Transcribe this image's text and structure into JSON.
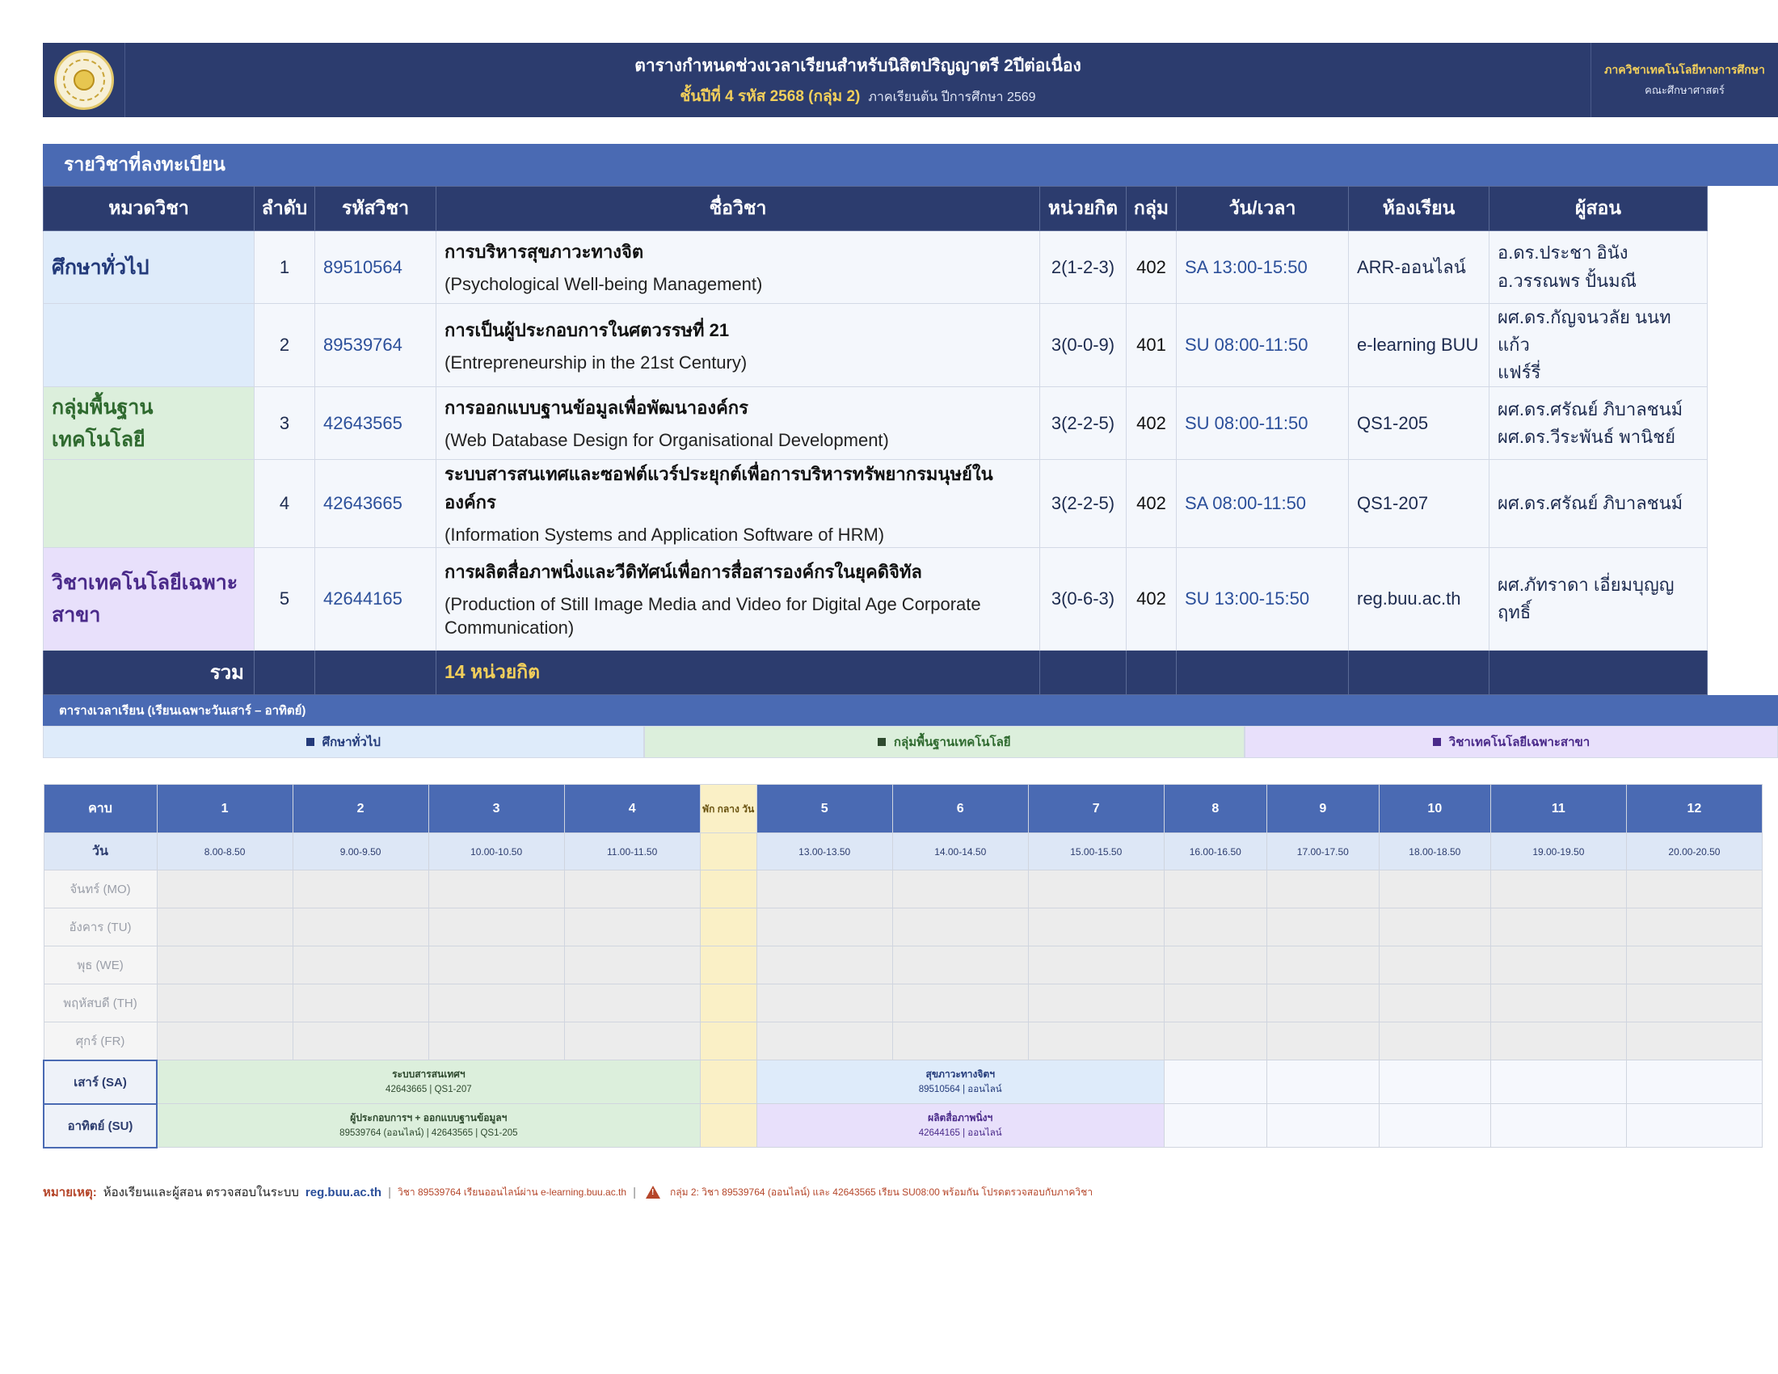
{
  "header": {
    "title": "ตารางกำหนดช่วงเวลาเรียนสำหรับนิสิตปริญญาตรี  2ปีต่อเนื่อง",
    "subtitle_highlight": "ชั้นปีที่ 4  รหัส 2568  (กลุ่ม 2)",
    "semester": "ภาคเรียนต้น ปีการศึกษา 2569",
    "dept": "ภาควิชาเทคโนโลยีทางการศึกษา",
    "faculty": "คณะศึกษาศาสตร์",
    "logo_icon": "university-seal-icon"
  },
  "courses": {
    "section_title": "รายวิชาที่ลงทะเบียน",
    "columns": [
      "หมวดวิชา",
      "ลำดับ",
      "รหัสวิชา",
      "ชื่อวิชา",
      "หน่วยกิต",
      "กลุ่ม",
      "วัน/เวลา",
      "ห้องเรียน",
      "ผู้สอน"
    ],
    "rows": [
      {
        "category": "ศึกษาทั่วไป",
        "no": "1",
        "code": "89510564",
        "name_th": "การบริหารสุขภาวะทางจิต",
        "name_en": "(Psychological Well-being Management)",
        "credits": "2(1-2-3)",
        "group": "402",
        "time": "SA 13:00-15:50",
        "room": "ARR-ออนไลน์",
        "inst1": "อ.ดร.ประชา อินัง",
        "inst2": "อ.วรรณพร ปั้นมณี"
      },
      {
        "category": "",
        "no": "2",
        "code": "89539764",
        "name_th": "การเป็นผู้ประกอบการในศตวรรษที่ 21",
        "name_en": "(Entrepreneurship in the 21st Century)",
        "credits": "3(0-0-9)",
        "group": "401",
        "time": "SU 08:00-11:50",
        "room": "e-learning BUU",
        "inst1": "ผศ.ดร.กัญจนวลัย นนทแก้ว",
        "inst2": "แฟร์รี่"
      },
      {
        "category": "กลุ่มพื้นฐานเทคโนโลยี",
        "no": "3",
        "code": "42643565",
        "name_th": "การออกแบบฐานข้อมูลเพื่อพัฒนาองค์กร",
        "name_en": "(Web Database Design for Organisational Development)",
        "credits": "3(2-2-5)",
        "group": "402",
        "time": "SU 08:00-11:50",
        "room": "QS1-205",
        "inst1": "ผศ.ดร.ศรัณย์ ภิบาลชนม์",
        "inst2": "ผศ.ดร.วีระพันธ์ พานิชย์"
      },
      {
        "category": "",
        "no": "4",
        "code": "42643665",
        "name_th": "ระบบสารสนเทศและซอฟต์แวร์ประยุกต์เพื่อการบริหารทรัพยากรมนุษย์ในองค์กร",
        "name_en": "(Information Systems and Application Software of HRM)",
        "credits": "3(2-2-5)",
        "group": "402",
        "time": "SA 08:00-11:50",
        "room": "QS1-207",
        "inst1": "ผศ.ดร.ศรัณย์ ภิบาลชนม์",
        "inst2": ""
      },
      {
        "category": "วิชาเทคโนโลยีเฉพาะสาขา",
        "no": "5",
        "code": "42644165",
        "name_th": "การผลิตสื่อภาพนิ่งและวีดิทัศน์เพื่อการสื่อสารองค์กรในยุคดิจิทัล",
        "name_en": "(Production of Still Image Media and Video for Digital Age Corporate Communication)",
        "credits": "3(0-6-3)",
        "group": "402",
        "time": "SU 13:00-15:50",
        "room": "reg.buu.ac.th",
        "inst1": "ผศ.ภัทราดา เอี่ยมบุญญฤทธิ์",
        "inst2": ""
      }
    ],
    "total_label": "รวม",
    "total_value": "14  หน่วยกิต"
  },
  "timetable": {
    "section_title": "ตารางเวลาเรียน  (เรียนเฉพาะวันเสาร์ – อาทิตย์)",
    "legend": [
      "ศึกษาทั่วไป",
      "กลุ่มพื้นฐานเทคโนโลยี",
      "วิชาเทคโนโลยีเฉพาะสาขา"
    ],
    "period_label": "คาบ",
    "day_label": "วัน",
    "lunch_label": "พัก กลาง วัน",
    "periods": [
      "1",
      "2",
      "3",
      "4",
      "5",
      "6",
      "7",
      "8",
      "9",
      "10",
      "11",
      "12"
    ],
    "times": [
      "8.00-8.50",
      "9.00-9.50",
      "10.00-10.50",
      "11.00-11.50",
      "13.00-13.50",
      "14.00-14.50",
      "15.00-15.50",
      "16.00-16.50",
      "17.00-17.50",
      "18.00-18.50",
      "19.00-19.50",
      "20.00-20.50"
    ],
    "weekdays": [
      "จันทร์ (MO)",
      "อังคาร (TU)",
      "พุธ (WE)",
      "พฤหัสบดี (TH)",
      "ศุกร์ (FR)"
    ],
    "saturday": {
      "label": "เสาร์ (SA)",
      "morning_title": "ระบบสารสนเทศฯ",
      "morning_detail": "42643665 | QS1-207",
      "afternoon_title": "สุขภาวะทางจิตฯ",
      "afternoon_detail": "89510564 | ออนไลน์"
    },
    "sunday": {
      "label": "อาทิตย์ (SU)",
      "morning_title": "ผู้ประกอบการฯ + ออกแบบฐานข้อมูลฯ",
      "morning_detail": "89539764 (ออนไลน์) | 42643565 | QS1-205",
      "afternoon_title": "ผลิตสื่อภาพนิ่งฯ",
      "afternoon_detail": "42644165 | ออนไลน์"
    },
    "colors": {
      "general": "#deebfa",
      "tech": "#dcefdc",
      "specialty": "#e8e0fb",
      "lunch": "#faf0c6",
      "header": "#2c3c6e",
      "accent": "#4a6ab3"
    }
  },
  "note": {
    "key": "หมายเหตุ:",
    "text1": "ห้องเรียนและผู้สอน ตรวจสอบในระบบ",
    "link": "reg.buu.ac.th",
    "sep": "|",
    "text2": "วิชา 89539764 เรียนออนไลน์ผ่าน e-learning.buu.ac.th",
    "warn_icon": "warning-icon",
    "text3": "กลุ่ม 2: วิชา 89539764 (ออนไลน์) และ 42643565 เรียน SU08:00 พร้อมกัน โปรดตรวจสอบกับภาควิชา"
  }
}
